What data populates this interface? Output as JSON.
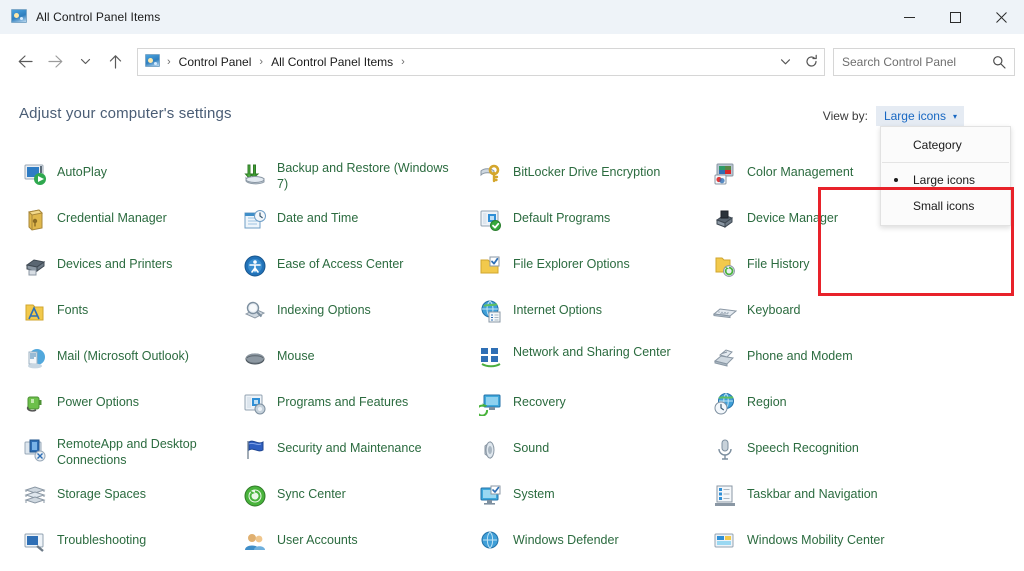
{
  "window": {
    "title": "All Control Panel Items",
    "icon": "control-panel-icon",
    "buttons": {
      "minimize": "—",
      "maximize": "□",
      "close": "✕"
    }
  },
  "navigation": {
    "back": "back-arrow",
    "forward": "forward-arrow",
    "recent": "recent-locations-chevron",
    "up": "up-arrow",
    "breadcrumb": [
      "Control Panel",
      "All Control Panel Items"
    ],
    "separator": "›",
    "dropdown_caret": "previous-locations",
    "refresh": "refresh"
  },
  "search": {
    "placeholder": "Search Control Panel",
    "icon": "search-icon"
  },
  "header": {
    "heading": "Adjust your computer's settings"
  },
  "view_by": {
    "label": "View by:",
    "value": "Large icons",
    "caret": "▾",
    "options": [
      "Category",
      "Large icons",
      "Small icons"
    ],
    "selected_index": 1,
    "accent_color": "#1767c2"
  },
  "annotation": {
    "color": "#e8222a"
  },
  "items": {
    "link_color": "#2b6b3f",
    "columns": [
      [
        {
          "label": "AutoPlay",
          "icon": "autoplay-icon"
        },
        {
          "label": "Credential Manager",
          "icon": "credential-manager-icon"
        },
        {
          "label": "Devices and Printers",
          "icon": "devices-and-printers-icon"
        },
        {
          "label": "Fonts",
          "icon": "fonts-icon"
        },
        {
          "label": "Mail (Microsoft Outlook)",
          "icon": "mail-icon"
        },
        {
          "label": "Power Options",
          "icon": "power-options-icon"
        },
        {
          "label": "RemoteApp and Desktop Connections",
          "icon": "remoteapp-icon"
        },
        {
          "label": "Storage Spaces",
          "icon": "storage-spaces-icon"
        },
        {
          "label": "Troubleshooting",
          "icon": "troubleshooting-icon"
        }
      ],
      [
        {
          "label": "Backup and Restore (Windows 7)",
          "icon": "backup-and-restore-icon"
        },
        {
          "label": "Date and Time",
          "icon": "date-and-time-icon"
        },
        {
          "label": "Ease of Access Center",
          "icon": "ease-of-access-icon"
        },
        {
          "label": "Indexing Options",
          "icon": "indexing-options-icon"
        },
        {
          "label": "Mouse",
          "icon": "mouse-icon"
        },
        {
          "label": "Programs and Features",
          "icon": "programs-and-features-icon"
        },
        {
          "label": "Security and Maintenance",
          "icon": "security-and-maintenance-icon"
        },
        {
          "label": "Sync Center",
          "icon": "sync-center-icon"
        },
        {
          "label": "User Accounts",
          "icon": "user-accounts-icon"
        }
      ],
      [
        {
          "label": "BitLocker Drive Encryption",
          "icon": "bitlocker-icon"
        },
        {
          "label": "Default Programs",
          "icon": "default-programs-icon"
        },
        {
          "label": "File Explorer Options",
          "icon": "file-explorer-options-icon"
        },
        {
          "label": "Internet Options",
          "icon": "internet-options-icon"
        },
        {
          "label": "Network and Sharing Center",
          "icon": "network-and-sharing-icon"
        },
        {
          "label": "Recovery",
          "icon": "recovery-icon"
        },
        {
          "label": "Sound",
          "icon": "sound-icon"
        },
        {
          "label": "System",
          "icon": "system-icon"
        },
        {
          "label": "Windows Defender",
          "icon": "windows-defender-icon"
        }
      ],
      [
        {
          "label": "Color Management",
          "icon": "color-management-icon"
        },
        {
          "label": "Device Manager",
          "icon": "device-manager-icon"
        },
        {
          "label": "File History",
          "icon": "file-history-icon"
        },
        {
          "label": "Keyboard",
          "icon": "keyboard-icon"
        },
        {
          "label": "Phone and Modem",
          "icon": "phone-and-modem-icon"
        },
        {
          "label": "Region",
          "icon": "region-icon"
        },
        {
          "label": "Speech Recognition",
          "icon": "speech-recognition-icon"
        },
        {
          "label": "Taskbar and Navigation",
          "icon": "taskbar-and-navigation-icon"
        },
        {
          "label": "Windows Mobility Center",
          "icon": "windows-mobility-center-icon"
        }
      ]
    ]
  }
}
